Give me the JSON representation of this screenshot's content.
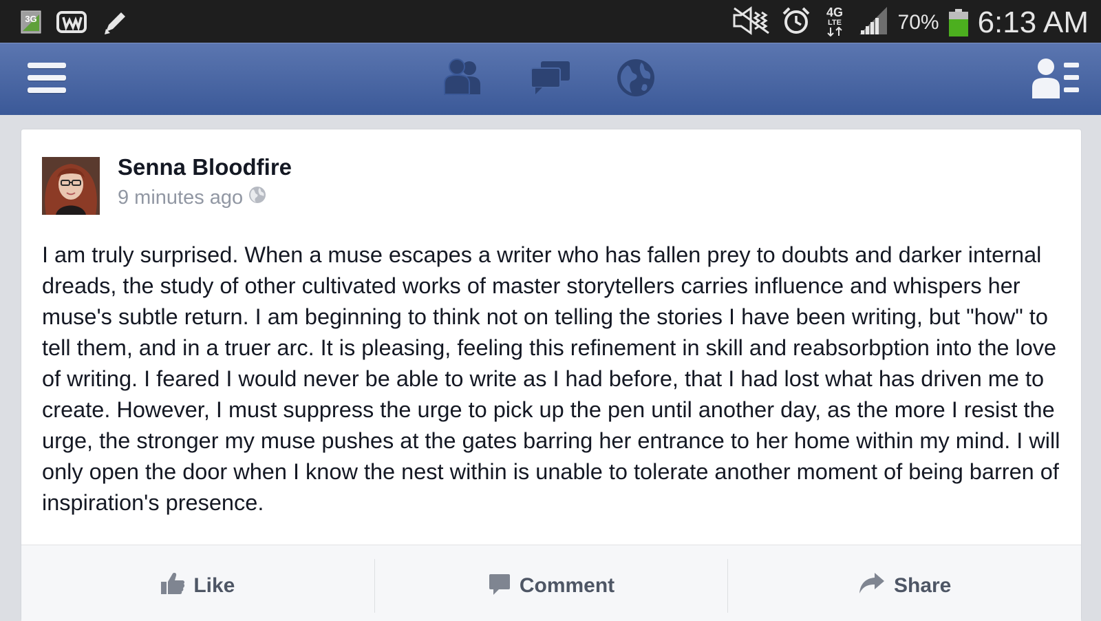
{
  "status_bar": {
    "network_badge": "3G",
    "network_type": "4G",
    "network_type_sub": "LTE",
    "battery_percent": "70%",
    "battery_level": 0.7,
    "time": "6:13 AM",
    "icons": [
      "3g-icon",
      "wunderlist-icon",
      "pencil-icon",
      "mute-icon",
      "alarm-icon",
      "4g-lte-icon",
      "signal-icon",
      "battery-icon"
    ]
  },
  "nav_bar": {
    "icons": [
      "menu-icon",
      "friend-requests-icon",
      "messages-icon",
      "notifications-globe-icon",
      "profile-list-icon"
    ],
    "color": "#3b5998"
  },
  "post": {
    "author": "Senna Bloodfire",
    "timestamp": "9 minutes ago",
    "privacy_icon": "globe-icon",
    "text": "I am truly surprised. When a muse escapes a writer who has fallen prey to doubts and darker internal dreads, the study of other cultivated works of master storytellers carries influence and whispers her muse's subtle return. I am beginning to think not on telling the stories I have been writing, but \"how\" to tell them, and in a truer arc. It is pleasing, feeling this refinement in skill and reabsorbption into the love of writing. I feared I would never be able to write as I had before, that I had lost what has driven me to create. However, I must suppress the urge to pick up the pen until another day, as the more I resist the urge, the stronger my muse pushes at the gates barring her entrance to her home within my mind. I will only open the door when I know the nest within is unable to tolerate another moment of being barren of inspiration's presence."
  },
  "actions": {
    "like": "Like",
    "comment": "Comment",
    "share": "Share"
  }
}
